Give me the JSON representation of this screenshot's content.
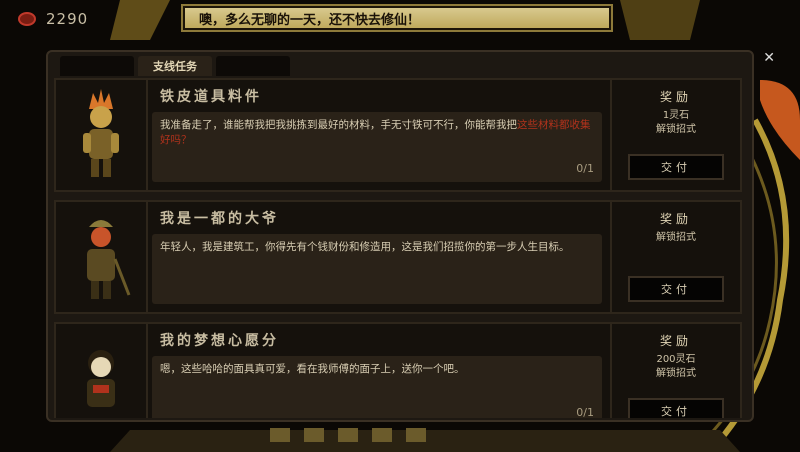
{
  "currency": {
    "value": "2290",
    "icon": "coin-icon"
  },
  "banner": {
    "text": "噢，多么无聊的一天，还不快去修仙！"
  },
  "tabs": [
    {
      "label": "",
      "active": false
    },
    {
      "label": "支线任务",
      "active": true
    },
    {
      "label": "",
      "active": false
    }
  ],
  "quests": [
    {
      "title": "铁皮道具料件",
      "desc_a": "我准备走了，谁能帮我把我挑拣到最好的材料，手无寸铁可不行，你能帮我把",
      "desc_b": "这些材料都收集好吗？",
      "progress": "0/1",
      "reward_title": "奖励",
      "reward_lines": [
        "1灵石",
        "解锁招式"
      ],
      "button": "交付"
    },
    {
      "title": "我是一都的大爷",
      "desc_a": "年轻人，我是建筑工，你得先有个钱财份和修造用，这是我们招揽你的第一步人生目标。",
      "desc_b": "",
      "progress": "",
      "reward_title": "奖励",
      "reward_lines": [
        "解锁招式"
      ],
      "button": "交付"
    },
    {
      "title": "我的梦想心愿分",
      "desc_a": "嗯，这些哈哈的面具真可爱，看在我师傅的面子上，送你一个吧。",
      "desc_b": "",
      "progress": "0/1",
      "reward_title": "奖励",
      "reward_lines": [
        "200灵石",
        "解锁招式"
      ],
      "button": "交付"
    }
  ],
  "colors": {
    "accent_red": "#b0321c",
    "banner_bg": "#d8c98e",
    "panel_bg": "#1d1812"
  }
}
